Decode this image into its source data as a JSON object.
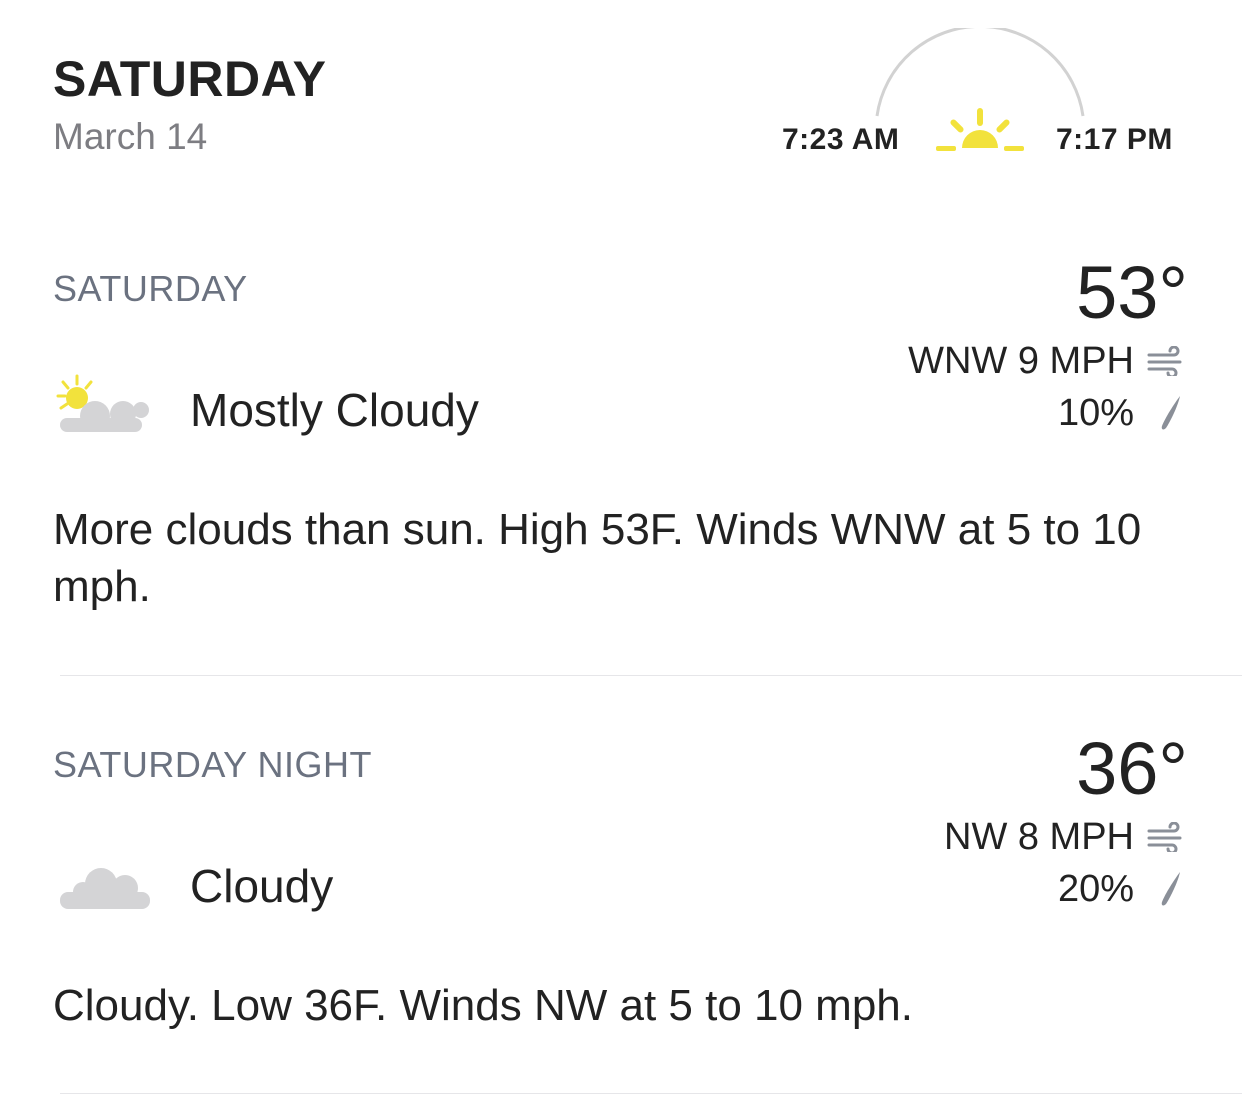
{
  "header": {
    "day": "SATURDAY",
    "date": "March 14",
    "sunrise": "7:23 AM",
    "sunset": "7:17 PM",
    "sun_color": "#f2e23c"
  },
  "periods": [
    {
      "label": "SATURDAY",
      "temperature": "53°",
      "wind": "WNW 9 MPH",
      "precip": "10%",
      "condition": "Mostly Cloudy",
      "condition_icon": "partly-cloudy-icon",
      "description": "More clouds than sun. High 53F. Winds WNW at 5 to 10 mph."
    },
    {
      "label": "SATURDAY NIGHT",
      "temperature": "36°",
      "wind": "NW 8 MPH",
      "precip": "20%",
      "condition": "Cloudy",
      "condition_icon": "cloudy-icon",
      "description": "Cloudy. Low 36F. Winds NW at 5 to 10 mph."
    }
  ],
  "colors": {
    "text": "#222222",
    "label": "#6b7280",
    "cloud": "#d4d4d6",
    "icon_gray": "#8a8f98"
  }
}
